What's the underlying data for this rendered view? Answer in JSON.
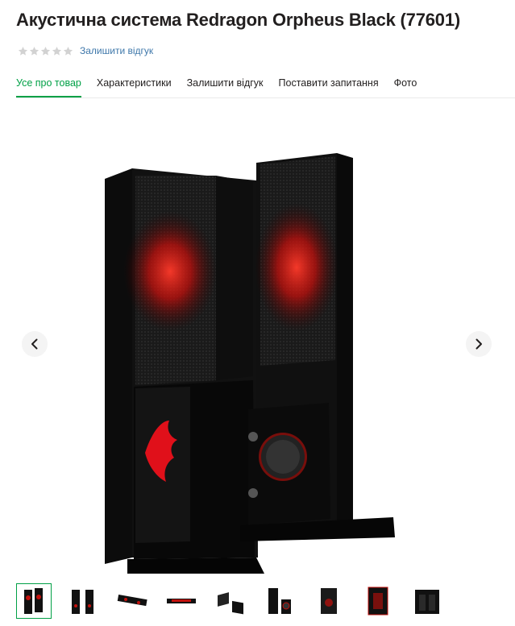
{
  "product": {
    "title": "Акустична система Redragon Orpheus Black (77601)",
    "rating": 0,
    "rating_max": 5,
    "review_link": "Залишити відгук"
  },
  "tabs": [
    {
      "label": "Усе про товар",
      "active": true
    },
    {
      "label": "Характеристики",
      "active": false
    },
    {
      "label": "Залишити відгук",
      "active": false
    },
    {
      "label": "Поставити запитання",
      "active": false
    },
    {
      "label": "Фото",
      "active": false
    }
  ],
  "gallery": {
    "prev_icon": "chevron-left-icon",
    "next_icon": "chevron-right-icon",
    "thumbnail_count": 9,
    "active_thumbnail": 1
  },
  "colors": {
    "accent": "#00a046",
    "link": "#3e77aa",
    "star_empty": "#d2d2d2",
    "speaker_red": "#e0101a"
  }
}
